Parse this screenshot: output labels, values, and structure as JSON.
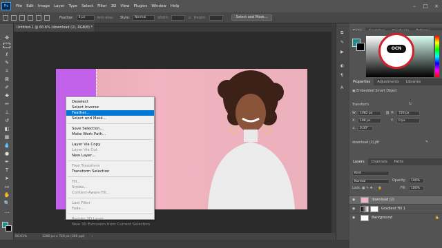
{
  "menubar": {
    "logo": "Ps",
    "items": [
      "File",
      "Edit",
      "Image",
      "Layer",
      "Type",
      "Select",
      "Filter",
      "3D",
      "View",
      "Plugins",
      "Window",
      "Help"
    ]
  },
  "options_bar": {
    "feather_label": "Feather:",
    "feather_value": "0 px",
    "antialias_label": "Anti-alias",
    "style_label": "Style:",
    "style_value": "Normal",
    "width_label": "Width:",
    "height_label": "Height:",
    "select_mask_label": "Select and Mask..."
  },
  "document": {
    "tab_title": "Untitled-1 @ 60.6% (download (2), RGB/8) *",
    "tab_close": "×"
  },
  "status": {
    "zoom": "60.61%",
    "doc_size": "1280 px x 720 px (300 ppi)",
    "arrow": "›"
  },
  "context_menu": {
    "groups": [
      [
        {
          "label": "Deselect",
          "enabled": true
        },
        {
          "label": "Select Inverse",
          "enabled": true
        },
        {
          "label": "Feather...",
          "enabled": true,
          "highlighted": true
        },
        {
          "label": "Select and Mask...",
          "enabled": true
        }
      ],
      [
        {
          "label": "Save Selection...",
          "enabled": true
        },
        {
          "label": "Make Work Path...",
          "enabled": true
        }
      ],
      [
        {
          "label": "Layer Via Copy",
          "enabled": true
        },
        {
          "label": "Layer Via Cut",
          "enabled": false
        },
        {
          "label": "New Layer...",
          "enabled": true
        }
      ],
      [
        {
          "label": "Free Transform",
          "enabled": false
        },
        {
          "label": "Transform Selection",
          "enabled": true
        }
      ],
      [
        {
          "label": "Fill...",
          "enabled": false
        },
        {
          "label": "Stroke...",
          "enabled": false
        },
        {
          "label": "Content-Aware Fill...",
          "enabled": false
        }
      ],
      [
        {
          "label": "Last Filter",
          "enabled": false
        },
        {
          "label": "Fade...",
          "enabled": false
        }
      ],
      [
        {
          "label": "Render 3D Layer",
          "enabled": false
        },
        {
          "label": "New 3D Extrusion from Current Selection",
          "enabled": false
        }
      ]
    ]
  },
  "color_panel": {
    "tabs": [
      "Color",
      "Swatches",
      "Gradients",
      "Patterns"
    ],
    "logo_text": "OCN",
    "foreground_color": "#1f8c8f",
    "background_color": "#000000"
  },
  "properties_panel": {
    "tabs": [
      "Properties",
      "Adjustments",
      "Libraries"
    ],
    "layer_kind": "Embedded Smart Object",
    "section": "Transform",
    "w_label": "W:",
    "w_value": "1082 px",
    "h_label": "H:",
    "h_value": "720 px",
    "x_label": "X:",
    "x_value": "198 px",
    "y_label": "Y:",
    "y_value": "0 px",
    "angle_value": "0.00°",
    "file_name": "download (2).jfif"
  },
  "layers_panel": {
    "tabs": [
      "Layers",
      "Channels",
      "Paths"
    ],
    "kind_label": "Kind",
    "blend_mode": "Normal",
    "opacity_label": "Opacity:",
    "opacity_value": "100%",
    "lock_label": "Lock:",
    "fill_label": "Fill:",
    "fill_value": "100%",
    "layers": [
      {
        "name": "download (2)",
        "selected": true
      },
      {
        "name": "Gradient Fill 1",
        "selected": false
      },
      {
        "name": "Background",
        "selected": false
      }
    ]
  }
}
